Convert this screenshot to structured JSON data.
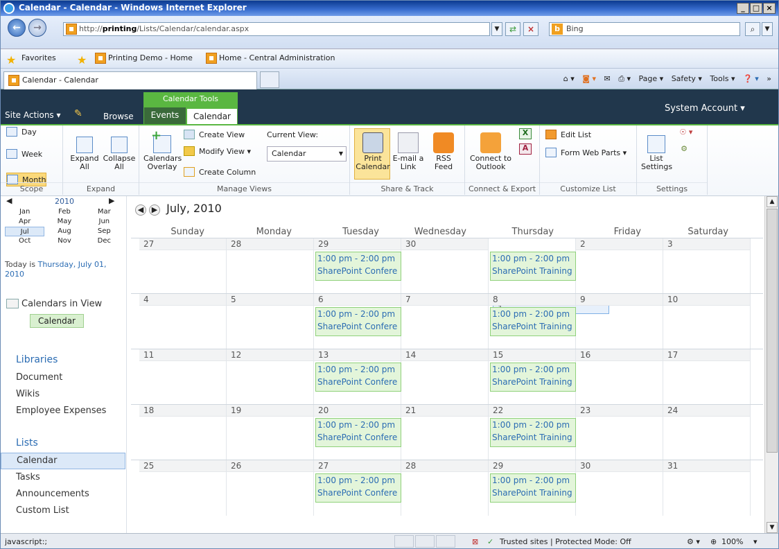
{
  "window": {
    "title": "Calendar - Calendar - Windows Internet Explorer"
  },
  "address": {
    "url_prefix": "http://",
    "url_host": "printing",
    "url_path": "/Lists/Calendar/calendar.aspx",
    "search_placeholder": "Bing"
  },
  "favorites": {
    "label": "Favorites",
    "links": [
      "Printing Demo - Home",
      "Home - Central Administration"
    ]
  },
  "browser_tab": {
    "label": "Calendar - Calendar"
  },
  "command_bar": {
    "page": "Page ▾",
    "safety": "Safety ▾",
    "tools": "Tools ▾"
  },
  "sp_top": {
    "site_actions": "Site Actions ▾",
    "browse": "Browse",
    "context_group": "Calendar Tools",
    "tab_events": "Events",
    "tab_calendar": "Calendar",
    "user": "System Account ▾"
  },
  "ribbon": {
    "scope": {
      "day": "Day",
      "week": "Week",
      "month": "Month",
      "label": "Scope"
    },
    "expand": {
      "expand_all": "Expand All",
      "collapse_all": "Collapse All",
      "label": "Expand"
    },
    "manage": {
      "calendars_overlay": "Calendars Overlay",
      "create_view": "Create View",
      "modify_view": "Modify View ▾",
      "create_column": "Create Column",
      "current_view_label": "Current View:",
      "current_view": "Calendar",
      "label": "Manage Views"
    },
    "share": {
      "print": "Print Calendar",
      "email": "E-mail a Link",
      "rss": "RSS Feed",
      "label": "Share & Track"
    },
    "connect": {
      "outlook": "Connect to Outlook",
      "label": "Connect & Export"
    },
    "customize": {
      "edit_list": "Edit List",
      "form_web_parts": "Form Web Parts ▾",
      "label": "Customize List"
    },
    "settings": {
      "list_settings": "List Settings",
      "label": "Settings"
    }
  },
  "picker": {
    "year": "2010",
    "months": [
      "Jan",
      "Feb",
      "Mar",
      "Apr",
      "May",
      "Jun",
      "Jul",
      "Aug",
      "Sep",
      "Oct",
      "Nov",
      "Dec"
    ],
    "today_prefix": "Today is",
    "today_link": "Thursday, July 01, 2010"
  },
  "leftnav": {
    "calendars_in_view": "Calendars in View",
    "calendar_chip": "Calendar",
    "libraries": "Libraries",
    "document": "Document",
    "wikis": "Wikis",
    "employee_expenses": "Employee Expenses",
    "lists": "Lists",
    "calendar": "Calendar",
    "tasks": "Tasks",
    "announcements": "Announcements",
    "custom_list": "Custom List"
  },
  "calendar": {
    "month_title": "July, 2010",
    "days_of_week": [
      "Sunday",
      "Monday",
      "Tuesday",
      "Wednesday",
      "Thursday",
      "Friday",
      "Saturday"
    ],
    "weeks": [
      [
        "27",
        "28",
        "29",
        "30",
        "1",
        "2",
        "3"
      ],
      [
        "4",
        "5",
        "6",
        "7",
        "8",
        "9",
        "10"
      ],
      [
        "11",
        "12",
        "13",
        "14",
        "15",
        "16",
        "17"
      ],
      [
        "18",
        "19",
        "20",
        "21",
        "22",
        "23",
        "24"
      ],
      [
        "25",
        "26",
        "27",
        "28",
        "29",
        "30",
        "31"
      ]
    ],
    "event_time": "1:00 pm - 2:00 pm",
    "event_tue": "SharePoint Confere",
    "event_thu": "SharePoint Training"
  },
  "status": {
    "left": "javascript:;",
    "zone": "Trusted sites | Protected Mode: Off",
    "zoom": "100%"
  }
}
